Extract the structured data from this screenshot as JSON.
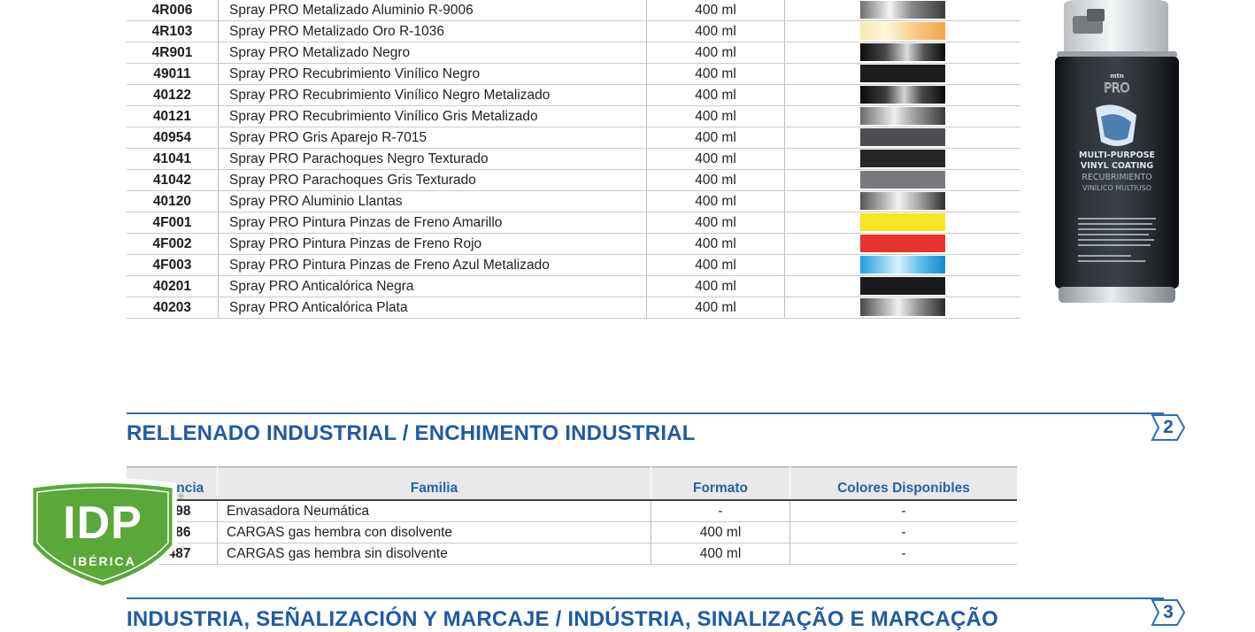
{
  "products": [
    {
      "ref": "4R006",
      "family": "Spray PRO Metalizado Aluminio R-9006",
      "format": "400 ml",
      "swatch": "linear-gradient(90deg,#6e6e6e 0%,#f4f4f4 35%,#8a8a8a 60%,#3a3a3a 100%)"
    },
    {
      "ref": "4R103",
      "family": "Spray PRO Metalizado Oro R-1036",
      "format": "400 ml",
      "swatch": "linear-gradient(90deg,#f4e9b0 0%,#fff7d8 30%,#f8c987 65%,#f3a54a 100%)"
    },
    {
      "ref": "4R901",
      "family": "Spray PRO Metalizado Negro",
      "format": "400 ml",
      "swatch": "linear-gradient(90deg,#0c0c0c 0%,#4a4a4a 30%,#dcdcdc 55%,#555 75%,#0a0a0a 100%)"
    },
    {
      "ref": "49011",
      "family": "Spray PRO Recubrimiento Vinílico Negro",
      "format": "400 ml",
      "swatch": "#1c1c1c"
    },
    {
      "ref": "40122",
      "family": "Spray PRO Recubrimiento Vinílico Negro Metalizado",
      "format": "400 ml",
      "swatch": "linear-gradient(90deg,#0b0b0b 0%,#3e3e3e 30%,#d4d4d4 52%,#4b4b4b 72%,#0a0a0a 100%)"
    },
    {
      "ref": "40121",
      "family": "Spray PRO Recubrimiento Vinílico Gris Metalizado",
      "format": "400 ml",
      "swatch": "linear-gradient(90deg,#6a6a6a 0%,#efefef 40%,#9a9a9a 65%,#3a3a3a 100%)"
    },
    {
      "ref": "40954",
      "family": "Spray PRO Gris Aparejo R-7015",
      "format": "400 ml",
      "swatch": "#4c4e52"
    },
    {
      "ref": "41041",
      "family": "Spray PRO Parachoques Negro Texturado",
      "format": "400 ml",
      "swatch": "#262626"
    },
    {
      "ref": "41042",
      "family": "Spray PRO Parachoques Gris Texturado",
      "format": "400 ml",
      "swatch": "#77797c"
    },
    {
      "ref": "40120",
      "family": "Spray PRO Aluminio Llantas",
      "format": "400 ml",
      "swatch": "linear-gradient(90deg,#555 0%,#f2f2f2 45%,#a2a2a2 70%,#2e2e2e 100%)"
    },
    {
      "ref": "4F001",
      "family": "Spray PRO Pintura Pinzas de Freno Amarillo",
      "format": "400 ml",
      "swatch": "#f6e521"
    },
    {
      "ref": "4F002",
      "family": "Spray PRO Pintura Pinzas de Freno Rojo",
      "format": "400 ml",
      "swatch": "#e9322b"
    },
    {
      "ref": "4F003",
      "family": "Spray PRO Pintura Pinzas de Freno Azul Metalizado",
      "format": "400 ml",
      "swatch": "linear-gradient(90deg,#1d9fe0 0%,#d9f1fb 45%,#5bc1ea 70%,#1289cf 100%)"
    },
    {
      "ref": "40201",
      "family": "Spray PRO Anticalórica Negra",
      "format": "400 ml",
      "swatch": "#1a1a1a"
    },
    {
      "ref": "40203",
      "family": "Spray PRO Anticalórica Plata",
      "format": "400 ml",
      "swatch": "linear-gradient(90deg,#4a4a4a 0%,#f0f0f0 45%,#8c8c8c 70%,#2b2b2b 100%)"
    }
  ],
  "can": {
    "brand": "mtn",
    "line": "PRO",
    "label_1": "MULTI-PURPOSE",
    "label_2": "VINYL COATING",
    "label_3": "RECUBRIMIENTO",
    "label_4": "VINÍLICO MULTIUSO"
  },
  "section2": {
    "title": "RELLENADO INDUSTRIAL / ENCHIMENTO INDUSTRIAL",
    "number": "2",
    "headers": {
      "ref": "Referencia",
      "family": "Familia",
      "format": "Formato",
      "colors": "Colores Disponibles"
    },
    "rows": [
      {
        "ref": "09498",
        "family": "Envasadora Neumática",
        "format": "-",
        "colors": "-"
      },
      {
        "ref": "09486",
        "family": "CARGAS gas hembra con disolvente",
        "format": "400 ml",
        "colors": "-"
      },
      {
        "ref": "09487",
        "family": "CARGAS gas hembra sin disolvente",
        "format": "400 ml",
        "colors": "-"
      }
    ]
  },
  "logo": {
    "text": "IDP",
    "subtext": "IBÉRICA",
    "mark": "®",
    "color": "#5aa83a"
  },
  "section3": {
    "title": "INDUSTRIA, SEÑALIZACIÓN Y MARCAJE / INDÚSTRIA, SINALIZAÇÃO E MARCAÇÃO",
    "number": "3"
  },
  "colors": {
    "accent": "#1f5aa6",
    "rule": "#2b6fb6",
    "header_bg": "#e9e9e9"
  }
}
